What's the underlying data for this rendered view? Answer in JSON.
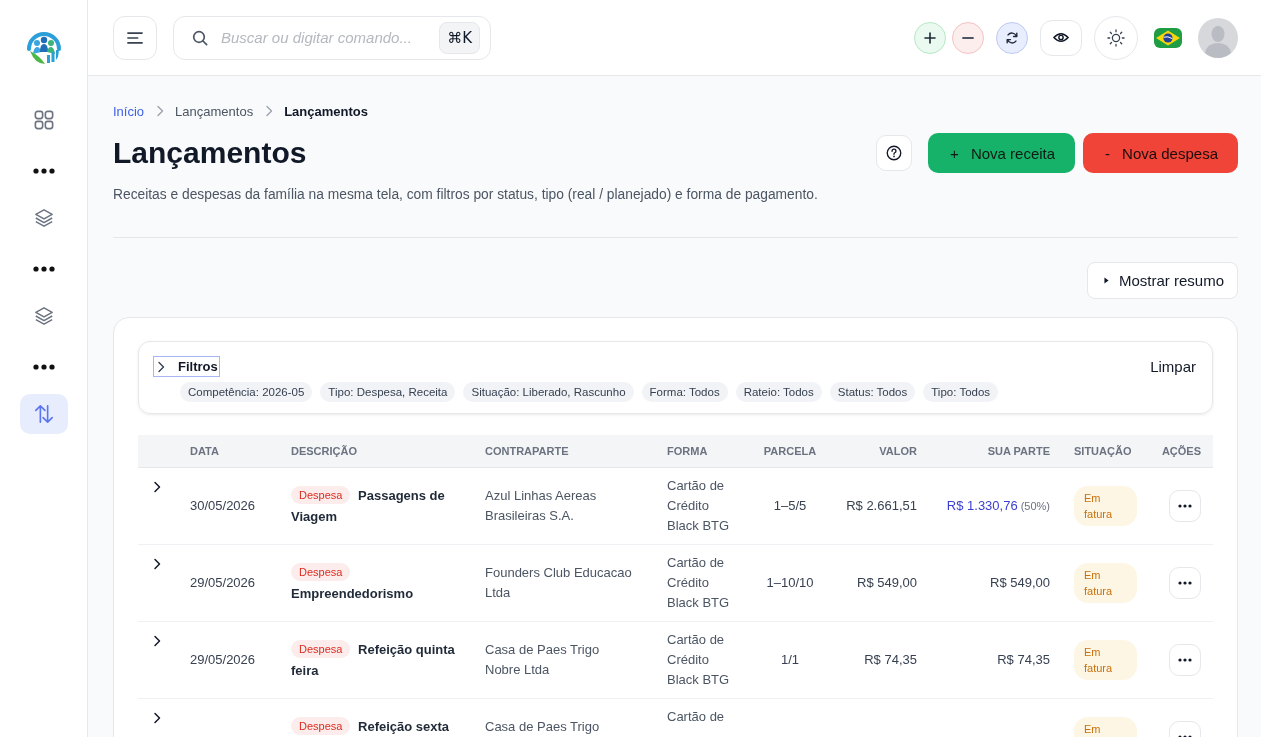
{
  "sidebar": {
    "items": [
      {
        "kind": "grid",
        "selected": false
      },
      {
        "kind": "more",
        "selected": false
      },
      {
        "kind": "layers",
        "selected": false
      },
      {
        "kind": "more",
        "selected": false
      },
      {
        "kind": "layers",
        "selected": false
      },
      {
        "kind": "more",
        "selected": false
      },
      {
        "kind": "transfers",
        "selected": true
      }
    ]
  },
  "topbar": {
    "search": {
      "placeholder": "Buscar ou digitar comando...",
      "shortcut": "⌘K"
    }
  },
  "breadcrumb": [
    {
      "label": "Início",
      "kind": "link"
    },
    {
      "label": "Lançamentos",
      "kind": "parent"
    },
    {
      "label": "Lançamentos",
      "kind": "current"
    }
  ],
  "page": {
    "title": "Lançamentos",
    "subtitle": "Receitas e despesas da família na mesma tela, com filtros por status, tipo (real / planejado) e forma de pagamento.",
    "actions": [
      {
        "kind": "help"
      },
      {
        "kind": "income",
        "glyph": "+",
        "label": "Nova receita"
      },
      {
        "kind": "expense",
        "glyph": "-",
        "label": "Nova despesa"
      }
    ]
  },
  "summary_toggle": {
    "label": "Mostrar resumo",
    "expanded": false
  },
  "filters": {
    "title": "Filtros",
    "expanded": false,
    "focused": true,
    "clear_label": "Limpar",
    "chips": [
      "Competência: 2026-05",
      "Tipo: Despesa, Receita",
      "Situação: Liberado, Rascunho",
      "Forma: Todos",
      "Rateio: Todos",
      "Status: Todos",
      "Tipo: Todos"
    ]
  },
  "table": {
    "columns": [
      "DATA",
      "DESCRIÇÃO",
      "CONTRAPARTE",
      "FORMA",
      "PARCELA",
      "VALOR",
      "SUA PARTE",
      "SITUAÇÃO",
      "AÇÕES"
    ],
    "rows": [
      {
        "expanded": false,
        "date": "30/05/2026",
        "type": {
          "label": "Despesa",
          "kind": "expense"
        },
        "description": "Passagens de Viagem",
        "counterparty": "Azul Linhas Aereas Brasileiras S.A.",
        "payment": "Cartão de Crédito Black BTG",
        "installment": "1–5/5",
        "amount": "R$ 2.661,51",
        "your_share": {
          "value": "R$ 1.330,76",
          "percent": "(50%)",
          "split": true
        },
        "status": {
          "label": "Em fatura",
          "kind": "invoiced"
        }
      },
      {
        "expanded": false,
        "date": "29/05/2026",
        "type": {
          "label": "Despesa",
          "kind": "expense"
        },
        "description": "Empreendedorismo",
        "counterparty": "Founders Club Educacao Ltda",
        "payment": "Cartão de Crédito Black BTG",
        "installment": "1–10/10",
        "amount": "R$ 549,00",
        "your_share": {
          "value": "R$ 549,00",
          "split": false
        },
        "status": {
          "label": "Em fatura",
          "kind": "invoiced"
        }
      },
      {
        "expanded": false,
        "date": "29/05/2026",
        "type": {
          "label": "Despesa",
          "kind": "expense"
        },
        "description": "Refeição quinta feira",
        "counterparty": "Casa de Paes Trigo Nobre Ltda",
        "payment": "Cartão de Crédito Black BTG",
        "installment": "1/1",
        "amount": "R$ 74,35",
        "your_share": {
          "value": "R$ 74,35",
          "split": false
        },
        "status": {
          "label": "Em fatura",
          "kind": "invoiced"
        }
      },
      {
        "expanded": false,
        "type": {
          "label": "Despesa",
          "kind": "expense"
        },
        "description": "Refeição sexta",
        "counterparty": "Casa de Paes Trigo",
        "payment": "Cartão de",
        "status": {
          "label": "Em",
          "kind": "invoiced"
        }
      }
    ]
  }
}
